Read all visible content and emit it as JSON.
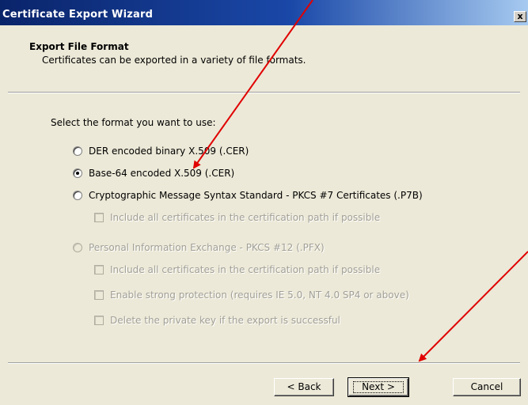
{
  "window": {
    "title": "Certificate Export Wizard",
    "close_glyph": "x"
  },
  "header": {
    "title": "Export File Format",
    "subtitle": "Certificates can be exported in a variety of file formats."
  },
  "body": {
    "prompt": "Select the format you want to use:",
    "formats": [
      {
        "label": "DER encoded binary X.509 (.CER)",
        "selected": false,
        "enabled": true
      },
      {
        "label": "Base-64 encoded X.509 (.CER)",
        "selected": true,
        "enabled": true
      },
      {
        "label": "Cryptographic Message Syntax Standard - PKCS #7 Certificates (.P7B)",
        "selected": false,
        "enabled": true
      },
      {
        "label": "Personal Information Exchange - PKCS #12 (.PFX)",
        "selected": false,
        "enabled": false
      }
    ],
    "p7b_options": [
      {
        "label": "Include all certificates in the certification path if possible",
        "checked": false,
        "enabled": false
      }
    ],
    "pfx_options": [
      {
        "label": "Include all certificates in the certification path if possible",
        "checked": false,
        "enabled": false
      },
      {
        "label": "Enable strong protection (requires IE 5.0, NT 4.0 SP4 or above)",
        "checked": false,
        "enabled": false
      },
      {
        "label": "Delete the private key if the export is successful",
        "checked": false,
        "enabled": false
      }
    ]
  },
  "buttons": {
    "back": "< Back",
    "next": "Next >",
    "cancel": "Cancel"
  },
  "annotations": {
    "arrow_color": "#e00000"
  }
}
